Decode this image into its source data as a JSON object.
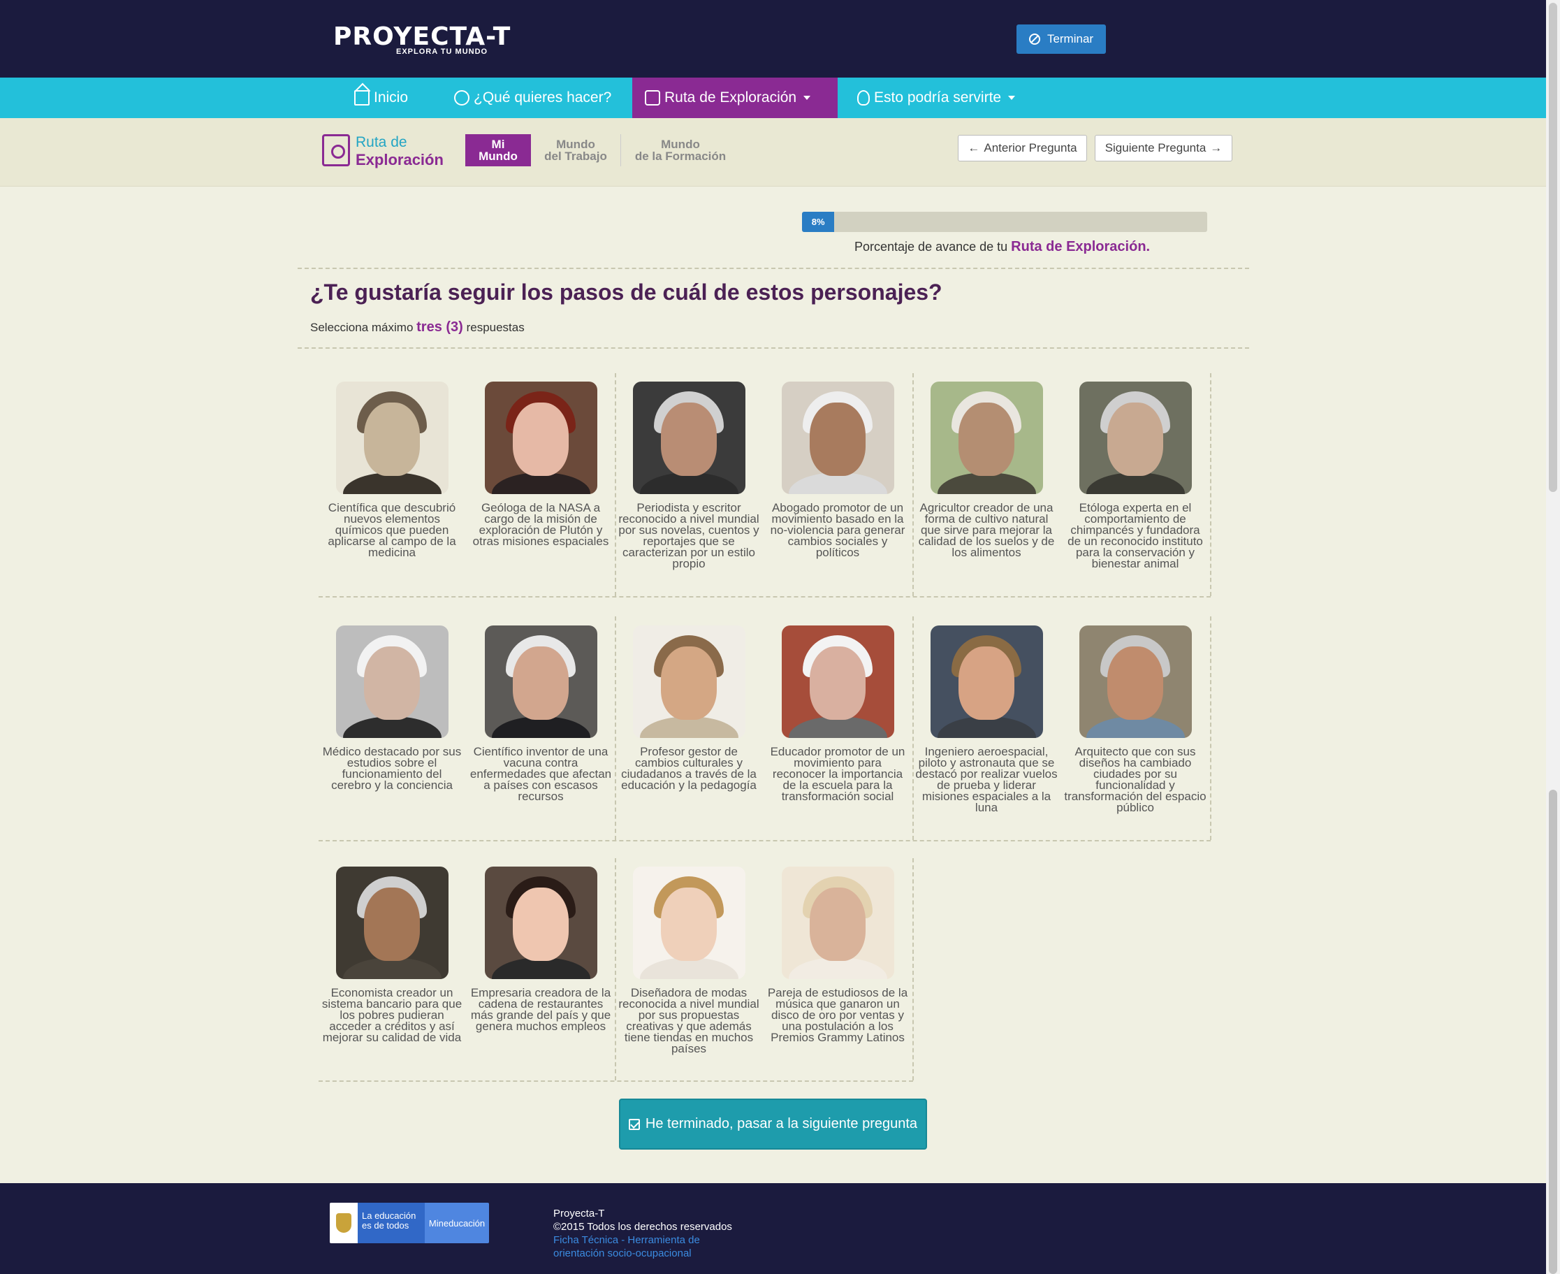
{
  "header": {
    "logo_text": "PROYECTA-T",
    "logo_tagline": "EXPLORA TU MUNDO",
    "terminar_label": "Terminar"
  },
  "nav": {
    "items": [
      {
        "label": "Inicio",
        "icon": "home-icon"
      },
      {
        "label": "¿Qué quieres hacer?",
        "icon": "search-icon"
      },
      {
        "label": "Ruta de Exploración",
        "icon": "document-search-icon",
        "active": true
      },
      {
        "label": "Esto podría servirte",
        "icon": "lightbulb-icon"
      }
    ]
  },
  "subnav": {
    "title_line1": "Ruta de",
    "title_line2": "Exploración",
    "tabs": [
      {
        "line1": "Mi",
        "line2": "Mundo",
        "active": true
      },
      {
        "line1": "Mundo",
        "line2": "del Trabajo"
      },
      {
        "line1": "Mundo",
        "line2": "de la Formación"
      }
    ],
    "prev_label": "Anterior Pregunta",
    "next_label": "Siguiente Pregunta"
  },
  "progress": {
    "value": 0.08,
    "label": "8%",
    "caption_prefix": "Porcentaje de avance de tu",
    "caption_highlight": "Ruta de Exploración."
  },
  "question": {
    "title": "¿Te gustaría seguir los pasos de cuál de estos personajes?",
    "instruction_prefix": "Selecciona máximo",
    "instruction_highlight": "tres (3)",
    "instruction_suffix": "respuestas"
  },
  "characters": [
    {
      "desc": "Científica que descubrió nuevos elementos químicos que pueden aplicarse al campo de la medicina"
    },
    {
      "desc": "Geóloga de la NASA a cargo de la misión de exploración de Plutón y otras misiones espaciales"
    },
    {
      "desc": "Periodista y escritor reconocido a nivel mundial por sus novelas, cuentos y reportajes que se caracterizan por un estilo propio"
    },
    {
      "desc": "Abogado promotor de un movimiento basado en la no-violencia para generar cambios sociales y políticos"
    },
    {
      "desc": "Agricultor creador de una forma de cultivo natural que sirve para mejorar la calidad de los suelos y de los alimentos"
    },
    {
      "desc": "Etóloga experta en el comportamiento de chimpancés y fundadora de un reconocido instituto para la conservación y bienestar animal"
    },
    {
      "desc": "Médico destacado por sus estudios sobre el funcionamiento del cerebro y la conciencia"
    },
    {
      "desc": "Científico inventor de una vacuna contra enfermedades que afectan a países con escasos recursos"
    },
    {
      "desc": "Profesor gestor de cambios culturales y ciudadanos a través de la educación y la pedagogía"
    },
    {
      "desc": "Educador promotor de un movimiento para reconocer la importancia de la escuela para la transformación social"
    },
    {
      "desc": "Ingeniero aeroespacial, piloto y astronauta que se destacó por realizar vuelos de prueba y liderar misiones espaciales a la luna"
    },
    {
      "desc": "Arquitecto que con sus diseños ha cambiado ciudades por su funcionalidad y transformación del espacio público"
    },
    {
      "desc": "Economista creador un sistema bancario para que los pobres pudieran acceder a créditos y así mejorar su calidad de vida"
    },
    {
      "desc": "Empresaria creadora de la cadena de restaurantes más grande del país y que genera muchos empleos"
    },
    {
      "desc": "Diseñadora de modas reconocida a nivel mundial por sus propuestas creativas y que además tiene tiendas en muchos países"
    },
    {
      "desc": "Pareja de estudiosos de la música que ganaron un disco de oro por ventas y una postulación a los Premios Grammy Latinos"
    }
  ],
  "finish_button": "He terminado, pasar a la siguiente pregunta",
  "footer": {
    "gov_left": "La educación es de todos",
    "gov_right": "Mineducación",
    "line1": "Proyecta-T",
    "line2": "©2015 Todos los derechos reservados",
    "link": "Ficha Técnica - Herramienta de orientación socio-ocupacional"
  },
  "colors": {
    "header_bg": "#1b1b3e",
    "nav_bg": "#23c0da",
    "accent_purple": "#8a2a93",
    "button_teal": "#1e9cac",
    "primary_blue": "#2a7dc4"
  }
}
